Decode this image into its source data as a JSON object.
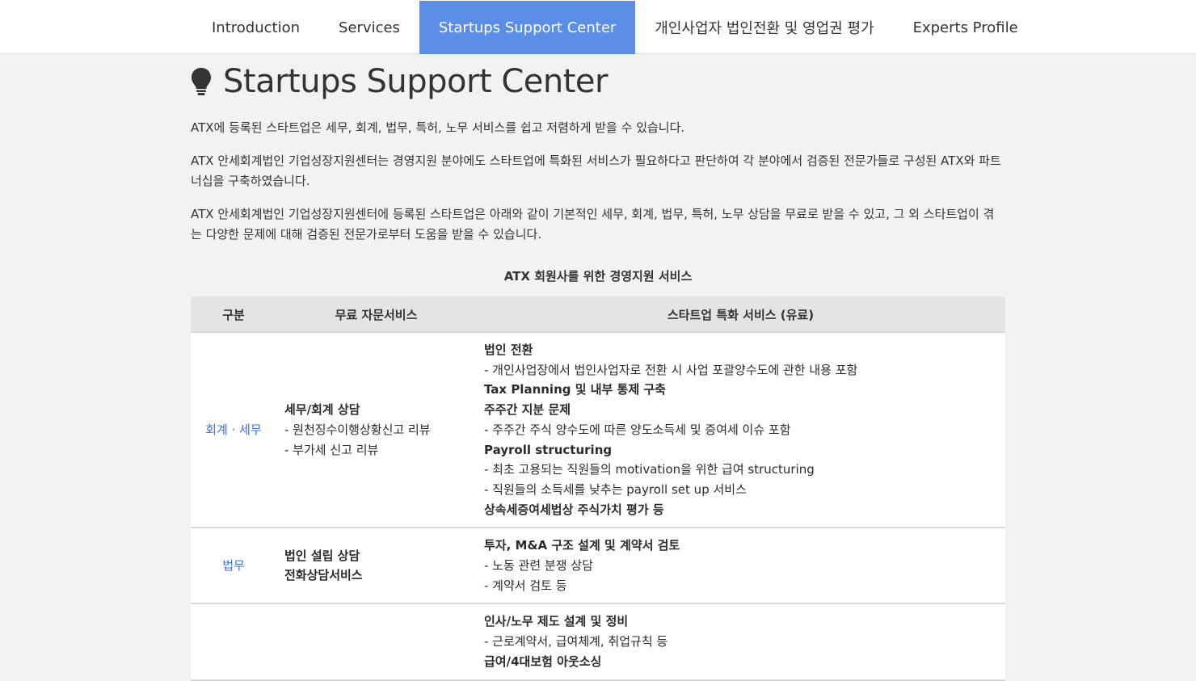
{
  "nav": {
    "items": [
      {
        "label": "Introduction"
      },
      {
        "label": "Services"
      },
      {
        "label": "Startups Support Center"
      },
      {
        "label": "개인사업자 법인전환 및 영업권 평가"
      },
      {
        "label": "Experts Profile"
      }
    ],
    "active_index": 2,
    "accent_color": "#5b8ee6"
  },
  "page": {
    "title": "Startups Support Center",
    "icon": "lightbulb-icon",
    "paragraphs": [
      "ATX에 등록된 스타트업은 세무, 회계, 법무, 특허, 노무 서비스를 쉽고 저렴하게 받을 수 있습니다.",
      "ATX 안세회계법인 기업성장지원센터는 경영지원 분야에도 스타트업에 특화된 서비스가 필요하다고 판단하여 각 분야에서 검증된 전문가들로 구성된 ATX와 파트너십을 구축하였습니다.",
      "ATX 안세회계법인 기업성장지원센터에 등록된 스타트업은 아래와 같이 기본적인 세무, 회계, 법무, 특허, 노무 상담을 무료로 받을 수 있고, 그 외 스타트업이 겪는 다양한 문제에 대해 검증된 전문가로부터 도움을 받을 수 있습니다."
    ]
  },
  "table": {
    "caption": "ATX 회원사를 위한 경영지원 서비스",
    "headers": [
      "구분",
      "무료 자문서비스",
      "스타트업 특화 서비스 (유료)"
    ],
    "rows": [
      {
        "category": "회계 · 세무",
        "free": [
          {
            "text": "세무/회계 상담",
            "bold": true
          },
          {
            "text": "- 원천징수이행상황신고 리뷰",
            "bold": false
          },
          {
            "text": "- 부가세 신고 리뷰",
            "bold": false
          }
        ],
        "paid": [
          {
            "text": "법인 전환",
            "bold": true
          },
          {
            "text": "- 개인사업장에서 법인사업자로 전환 시 사업 포괄양수도에 관한 내용 포함",
            "bold": false
          },
          {
            "text": "Tax Planning 및 내부 통제 구축",
            "bold": true
          },
          {
            "text": "주주간 지분 문제",
            "bold": true
          },
          {
            "text": "- 주주간 주식 양수도에 따른 양도소득세 및 증여세 이슈 포함",
            "bold": false
          },
          {
            "text": "Payroll structuring",
            "bold": true
          },
          {
            "text": "- 최초 고용되는 직원들의 motivation을 위한 급여 structuring",
            "bold": false
          },
          {
            "text": "- 직원들의 소득세를 낮추는 payroll set up 서비스",
            "bold": false
          },
          {
            "text": "상속세증여세법상 주식가치 평가 등",
            "bold": true
          }
        ]
      },
      {
        "category": "법무",
        "free": [
          {
            "text": "법인 설립 상담",
            "bold": true
          },
          {
            "text": "전화상담서비스",
            "bold": true
          }
        ],
        "paid": [
          {
            "text": "투자, M&A 구조 설계 및 계약서 검토",
            "bold": true
          },
          {
            "text": "- 노동 관련 분쟁 상담",
            "bold": false
          },
          {
            "text": "- 계약서 검토 등",
            "bold": false
          }
        ]
      },
      {
        "category": "",
        "free": [],
        "paid": [
          {
            "text": "인사/노무 제도 설계 및 정비",
            "bold": true
          },
          {
            "text": "- 근로계약서, 급여체계, 취업규칙 등",
            "bold": false
          },
          {
            "text": "급여/4대보험 아웃소싱",
            "bold": true
          }
        ]
      }
    ]
  }
}
